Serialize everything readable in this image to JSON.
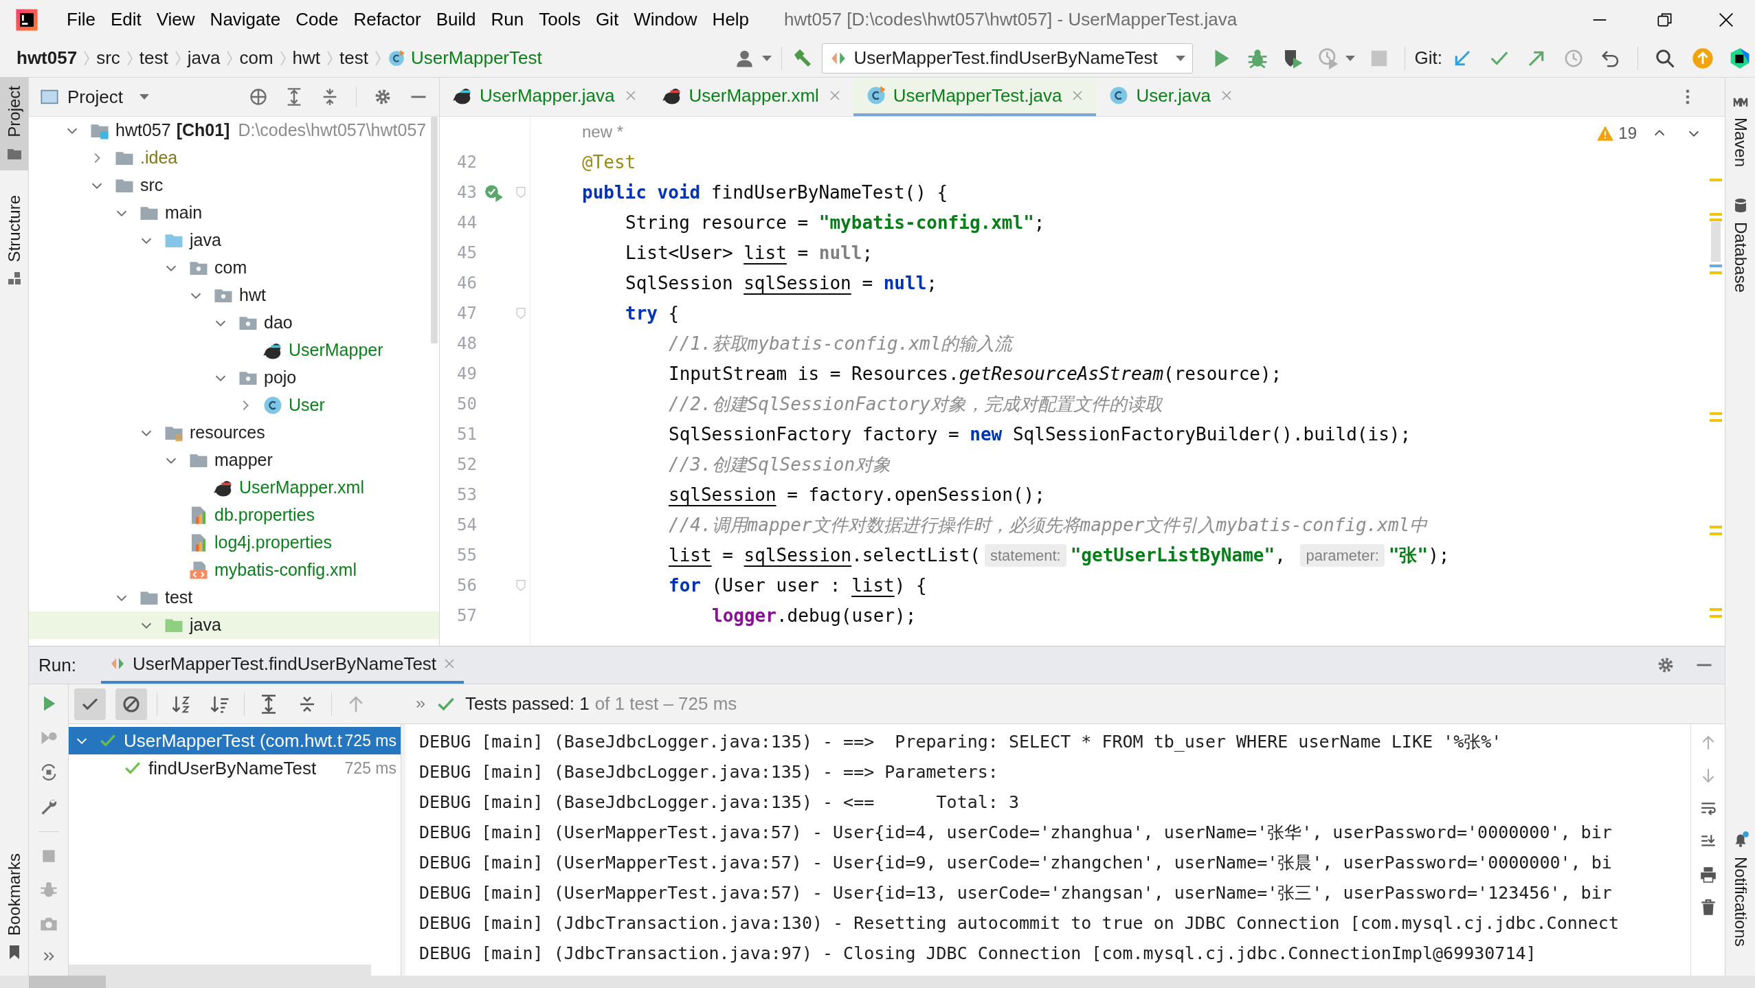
{
  "window": {
    "title": "hwt057 [D:\\codes\\hwt057\\hwt057] - UserMapperTest.java"
  },
  "menu": [
    "File",
    "Edit",
    "View",
    "Navigate",
    "Code",
    "Refactor",
    "Build",
    "Run",
    "Tools",
    "Git",
    "Window",
    "Help"
  ],
  "breadcrumb": [
    "hwt057",
    "src",
    "test",
    "java",
    "com",
    "hwt",
    "test",
    "UserMapperTest"
  ],
  "run_config": "UserMapperTest.findUserByNameTest",
  "git_label": "Git:",
  "left_tool_tabs": [
    {
      "label": "Project",
      "selected": true
    },
    {
      "label": "Structure",
      "selected": false
    }
  ],
  "left_bottom_tabs": [
    {
      "label": "Bookmarks",
      "selected": false
    }
  ],
  "right_tool_tabs": [
    {
      "label": "Maven",
      "selected": false
    },
    {
      "label": "Database",
      "selected": false
    }
  ],
  "right_bottom_tabs": [
    {
      "label": "Notifications",
      "selected": false
    }
  ],
  "project_panel": {
    "title": "Project",
    "tree": [
      {
        "label": "hwt057",
        "module": "[Ch01]",
        "path": "D:\\codes\\hwt057\\hwt057",
        "kind": "module",
        "expanded": true,
        "selected": false,
        "children": [
          {
            "label": ".idea",
            "kind": "folder",
            "color": "#827717",
            "expanded": false,
            "selected": false
          },
          {
            "label": "src",
            "kind": "folder",
            "expanded": true,
            "selected": false,
            "children": [
              {
                "label": "main",
                "kind": "folder",
                "expanded": true,
                "selected": false,
                "children": [
                  {
                    "label": "java",
                    "kind": "source",
                    "expanded": true,
                    "selected": false,
                    "children": [
                      {
                        "label": "com",
                        "kind": "package",
                        "expanded": true,
                        "selected": false,
                        "children": [
                          {
                            "label": "hwt",
                            "kind": "package",
                            "expanded": true,
                            "selected": false,
                            "children": [
                              {
                                "label": "dao",
                                "kind": "package",
                                "expanded": true,
                                "selected": false,
                                "children": [
                                  {
                                    "label": "UserMapper",
                                    "kind": "mapper-java",
                                    "color": "#0a7f1a",
                                    "selected": false
                                  }
                                ]
                              },
                              {
                                "label": "pojo",
                                "kind": "package",
                                "expanded": true,
                                "selected": false,
                                "children": [
                                  {
                                    "label": "User",
                                    "kind": "class",
                                    "color": "#0a7f1a",
                                    "expanded": false,
                                    "selected": false
                                  }
                                ]
                              }
                            ]
                          }
                        ]
                      }
                    ]
                  },
                  {
                    "label": "resources",
                    "kind": "resources",
                    "expanded": true,
                    "selected": false,
                    "children": [
                      {
                        "label": "mapper",
                        "kind": "folder",
                        "expanded": true,
                        "selected": false,
                        "children": [
                          {
                            "label": "UserMapper.xml",
                            "kind": "mapper-xml",
                            "color": "#0a7f1a",
                            "selected": false
                          }
                        ]
                      },
                      {
                        "label": "db.properties",
                        "kind": "properties",
                        "color": "#0a7f1a",
                        "selected": false
                      },
                      {
                        "label": "log4j.properties",
                        "kind": "properties",
                        "color": "#0a7f1a",
                        "selected": false
                      },
                      {
                        "label": "mybatis-config.xml",
                        "kind": "xml",
                        "color": "#0a7f1a",
                        "selected": false
                      }
                    ]
                  }
                ]
              },
              {
                "label": "test",
                "kind": "folder",
                "expanded": true,
                "selected": false,
                "children": [
                  {
                    "label": "java",
                    "kind": "test-source",
                    "expanded": true,
                    "selected": true
                  }
                ]
              }
            ]
          }
        ]
      }
    ]
  },
  "editor_tabs": [
    {
      "label": "UserMapper.java",
      "kind": "mapper-java",
      "selected": false
    },
    {
      "label": "UserMapper.xml",
      "kind": "mapper-xml",
      "selected": false
    },
    {
      "label": "UserMapperTest.java",
      "kind": "test-class",
      "selected": true
    },
    {
      "label": "User.java",
      "kind": "class",
      "selected": false
    }
  ],
  "editor": {
    "author_hint": "new *",
    "warnings": "19",
    "lines": [
      {
        "number": "42",
        "fold": false,
        "run": false,
        "tokens": [
          {
            "kind": "annotation",
            "text": "@Test"
          }
        ]
      },
      {
        "number": "43",
        "fold": true,
        "run": true,
        "tokens": [
          {
            "kind": "keyword",
            "text": "public void "
          },
          {
            "kind": "plain",
            "text": "findUserByNameTest() {"
          }
        ],
        "children": [
          {
            "number": "44",
            "fold": false,
            "run": false,
            "tokens": [
              {
                "kind": "plain",
                "text": "String resource = "
              },
              {
                "kind": "string",
                "text": "\"mybatis-config.xml\""
              },
              {
                "kind": "plain",
                "text": ";"
              }
            ]
          },
          {
            "number": "45",
            "fold": false,
            "run": false,
            "tokens": [
              {
                "kind": "plain",
                "text": "List<User> "
              },
              {
                "kind": "underlined",
                "text": "list"
              },
              {
                "kind": "plain",
                "text": " = "
              },
              {
                "kind": "redundant",
                "text": "null"
              },
              {
                "kind": "plain",
                "text": ";"
              }
            ]
          },
          {
            "number": "46",
            "fold": false,
            "run": false,
            "tokens": [
              {
                "kind": "plain",
                "text": "SqlSession "
              },
              {
                "kind": "underlined",
                "text": "sqlSession"
              },
              {
                "kind": "plain",
                "text": " = "
              },
              {
                "kind": "keyword",
                "text": "null"
              },
              {
                "kind": "plain",
                "text": ";"
              }
            ]
          },
          {
            "number": "47",
            "fold": true,
            "run": false,
            "tokens": [
              {
                "kind": "keyword",
                "text": "try"
              },
              {
                "kind": "plain",
                "text": " {"
              }
            ],
            "children": [
              {
                "number": "48",
                "fold": false,
                "run": false,
                "tokens": [
                  {
                    "kind": "comment",
                    "text": "//1.获取mybatis-config.xml的输入流"
                  }
                ]
              },
              {
                "number": "49",
                "fold": false,
                "run": false,
                "tokens": [
                  {
                    "kind": "plain",
                    "text": "InputStream is = Resources."
                  },
                  {
                    "kind": "italic",
                    "text": "getResourceAsStream"
                  },
                  {
                    "kind": "plain",
                    "text": "(resource);"
                  }
                ]
              },
              {
                "number": "50",
                "fold": false,
                "run": false,
                "tokens": [
                  {
                    "kind": "comment",
                    "text": "//2.创建SqlSessionFactory对象，完成对配置文件的读取"
                  }
                ]
              },
              {
                "number": "51",
                "fold": false,
                "run": false,
                "tokens": [
                  {
                    "kind": "plain",
                    "text": "SqlSessionFactory factory = "
                  },
                  {
                    "kind": "keyword",
                    "text": "new"
                  },
                  {
                    "kind": "plain",
                    "text": " SqlSessionFactoryBuilder().build(is);"
                  }
                ]
              },
              {
                "number": "52",
                "fold": false,
                "run": false,
                "tokens": [
                  {
                    "kind": "comment",
                    "text": "//3.创建SqlSession对象"
                  }
                ]
              },
              {
                "number": "53",
                "fold": false,
                "run": false,
                "tokens": [
                  {
                    "kind": "underlined",
                    "text": "sqlSession"
                  },
                  {
                    "kind": "plain",
                    "text": " = factory.openSession();"
                  }
                ]
              },
              {
                "number": "54",
                "fold": false,
                "run": false,
                "tokens": [
                  {
                    "kind": "comment",
                    "text": "//4.调用mapper文件对数据进行操作时，必须先将mapper文件引入mybatis-config.xml中"
                  }
                ]
              },
              {
                "number": "55",
                "fold": false,
                "run": false,
                "tokens": [
                  {
                    "kind": "underlined",
                    "text": "list"
                  },
                  {
                    "kind": "plain",
                    "text": " = "
                  },
                  {
                    "kind": "underlined",
                    "text": "sqlSession"
                  },
                  {
                    "kind": "plain",
                    "text": ".selectList("
                  },
                  {
                    "kind": "hint",
                    "text": "statement:"
                  },
                  {
                    "kind": "string",
                    "text": "\"getUserListByName\""
                  },
                  {
                    "kind": "plain",
                    "text": ", "
                  },
                  {
                    "kind": "hint",
                    "text": "parameter:"
                  },
                  {
                    "kind": "string",
                    "text": "\"张\""
                  },
                  {
                    "kind": "plain",
                    "text": ");"
                  }
                ]
              },
              {
                "number": "56",
                "fold": true,
                "run": false,
                "tokens": [
                  {
                    "kind": "keyword",
                    "text": "for"
                  },
                  {
                    "kind": "plain",
                    "text": " (User user : "
                  },
                  {
                    "kind": "underlined",
                    "text": "list"
                  },
                  {
                    "kind": "plain",
                    "text": ") {"
                  }
                ],
                "children": [
                  {
                    "number": "57",
                    "fold": false,
                    "run": false,
                    "tokens": [
                      {
                        "kind": "field",
                        "text": "logger"
                      },
                      {
                        "kind": "plain",
                        "text": ".debug(user);"
                      }
                    ]
                  }
                ]
              }
            ]
          }
        ]
      }
    ]
  },
  "run_panel": {
    "label": "Run:",
    "tab": "UserMapperTest.findUserByNameTest",
    "toggles": [
      {
        "kind": "passed",
        "on": true
      },
      {
        "kind": "ignored",
        "on": true
      }
    ],
    "status": "Tests passed: 1",
    "summary": "of 1 test – 725 ms",
    "tests": [
      {
        "label": "UserMapperTest (com.hwt.t",
        "time": "725 ms",
        "expanded": true,
        "selected": true,
        "children": [
          {
            "label": "findUserByNameTest",
            "time": "725 ms",
            "selected": false
          }
        ]
      }
    ],
    "console": [
      "DEBUG [main] (BaseJdbcLogger.java:135) - ==>  Preparing: SELECT * FROM tb_user WHERE userName LIKE '%张%'",
      "DEBUG [main] (BaseJdbcLogger.java:135) - ==> Parameters:",
      "DEBUG [main] (BaseJdbcLogger.java:135) - <==      Total: 3",
      "DEBUG [main] (UserMapperTest.java:57) - User{id=4, userCode='zhanghua', userName='张华', userPassword='0000000', bir",
      "DEBUG [main] (UserMapperTest.java:57) - User{id=9, userCode='zhangchen', userName='张晨', userPassword='0000000', bi",
      "DEBUG [main] (UserMapperTest.java:57) - User{id=13, userCode='zhangsan', userName='张三', userPassword='123456', bir",
      "DEBUG [main] (JdbcTransaction.java:130) - Resetting autocommit to true on JDBC Connection [com.mysql.cj.jdbc.Connect",
      "DEBUG [main] (JdbcTransaction.java:97) - Closing JDBC Connection [com.mysql.cj.jdbc.ConnectionImpl@69930714]"
    ]
  }
}
